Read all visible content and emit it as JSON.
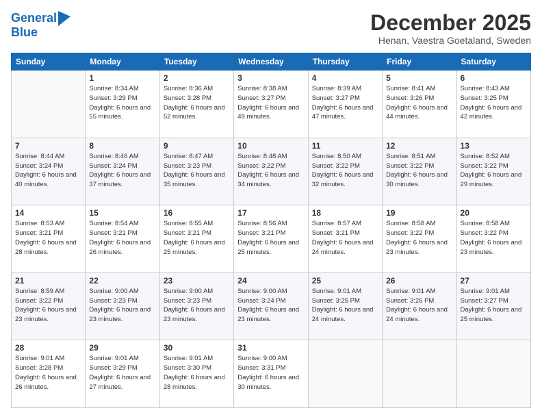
{
  "logo": {
    "line1": "General",
    "line2": "Blue"
  },
  "title": "December 2025",
  "subtitle": "Henan, Vaestra Goetaland, Sweden",
  "days_of_week": [
    "Sunday",
    "Monday",
    "Tuesday",
    "Wednesday",
    "Thursday",
    "Friday",
    "Saturday"
  ],
  "weeks": [
    [
      {
        "day": "",
        "info": ""
      },
      {
        "day": "1",
        "info": "Sunrise: 8:34 AM\nSunset: 3:29 PM\nDaylight: 6 hours\nand 55 minutes."
      },
      {
        "day": "2",
        "info": "Sunrise: 8:36 AM\nSunset: 3:28 PM\nDaylight: 6 hours\nand 52 minutes."
      },
      {
        "day": "3",
        "info": "Sunrise: 8:38 AM\nSunset: 3:27 PM\nDaylight: 6 hours\nand 49 minutes."
      },
      {
        "day": "4",
        "info": "Sunrise: 8:39 AM\nSunset: 3:27 PM\nDaylight: 6 hours\nand 47 minutes."
      },
      {
        "day": "5",
        "info": "Sunrise: 8:41 AM\nSunset: 3:26 PM\nDaylight: 6 hours\nand 44 minutes."
      },
      {
        "day": "6",
        "info": "Sunrise: 8:43 AM\nSunset: 3:25 PM\nDaylight: 6 hours\nand 42 minutes."
      }
    ],
    [
      {
        "day": "7",
        "info": "Sunrise: 8:44 AM\nSunset: 3:24 PM\nDaylight: 6 hours\nand 40 minutes."
      },
      {
        "day": "8",
        "info": "Sunrise: 8:46 AM\nSunset: 3:24 PM\nDaylight: 6 hours\nand 37 minutes."
      },
      {
        "day": "9",
        "info": "Sunrise: 8:47 AM\nSunset: 3:23 PM\nDaylight: 6 hours\nand 35 minutes."
      },
      {
        "day": "10",
        "info": "Sunrise: 8:48 AM\nSunset: 3:22 PM\nDaylight: 6 hours\nand 34 minutes."
      },
      {
        "day": "11",
        "info": "Sunrise: 8:50 AM\nSunset: 3:22 PM\nDaylight: 6 hours\nand 32 minutes."
      },
      {
        "day": "12",
        "info": "Sunrise: 8:51 AM\nSunset: 3:22 PM\nDaylight: 6 hours\nand 30 minutes."
      },
      {
        "day": "13",
        "info": "Sunrise: 8:52 AM\nSunset: 3:22 PM\nDaylight: 6 hours\nand 29 minutes."
      }
    ],
    [
      {
        "day": "14",
        "info": "Sunrise: 8:53 AM\nSunset: 3:21 PM\nDaylight: 6 hours\nand 28 minutes."
      },
      {
        "day": "15",
        "info": "Sunrise: 8:54 AM\nSunset: 3:21 PM\nDaylight: 6 hours\nand 26 minutes."
      },
      {
        "day": "16",
        "info": "Sunrise: 8:55 AM\nSunset: 3:21 PM\nDaylight: 6 hours\nand 25 minutes."
      },
      {
        "day": "17",
        "info": "Sunrise: 8:56 AM\nSunset: 3:21 PM\nDaylight: 6 hours\nand 25 minutes."
      },
      {
        "day": "18",
        "info": "Sunrise: 8:57 AM\nSunset: 3:21 PM\nDaylight: 6 hours\nand 24 minutes."
      },
      {
        "day": "19",
        "info": "Sunrise: 8:58 AM\nSunset: 3:22 PM\nDaylight: 6 hours\nand 23 minutes."
      },
      {
        "day": "20",
        "info": "Sunrise: 8:58 AM\nSunset: 3:22 PM\nDaylight: 6 hours\nand 23 minutes."
      }
    ],
    [
      {
        "day": "21",
        "info": "Sunrise: 8:59 AM\nSunset: 3:22 PM\nDaylight: 6 hours\nand 23 minutes."
      },
      {
        "day": "22",
        "info": "Sunrise: 9:00 AM\nSunset: 3:23 PM\nDaylight: 6 hours\nand 23 minutes."
      },
      {
        "day": "23",
        "info": "Sunrise: 9:00 AM\nSunset: 3:23 PM\nDaylight: 6 hours\nand 23 minutes."
      },
      {
        "day": "24",
        "info": "Sunrise: 9:00 AM\nSunset: 3:24 PM\nDaylight: 6 hours\nand 23 minutes."
      },
      {
        "day": "25",
        "info": "Sunrise: 9:01 AM\nSunset: 3:25 PM\nDaylight: 6 hours\nand 24 minutes."
      },
      {
        "day": "26",
        "info": "Sunrise: 9:01 AM\nSunset: 3:26 PM\nDaylight: 6 hours\nand 24 minutes."
      },
      {
        "day": "27",
        "info": "Sunrise: 9:01 AM\nSunset: 3:27 PM\nDaylight: 6 hours\nand 25 minutes."
      }
    ],
    [
      {
        "day": "28",
        "info": "Sunrise: 9:01 AM\nSunset: 3:28 PM\nDaylight: 6 hours\nand 26 minutes."
      },
      {
        "day": "29",
        "info": "Sunrise: 9:01 AM\nSunset: 3:29 PM\nDaylight: 6 hours\nand 27 minutes."
      },
      {
        "day": "30",
        "info": "Sunrise: 9:01 AM\nSunset: 3:30 PM\nDaylight: 6 hours\nand 28 minutes."
      },
      {
        "day": "31",
        "info": "Sunrise: 9:00 AM\nSunset: 3:31 PM\nDaylight: 6 hours\nand 30 minutes."
      },
      {
        "day": "",
        "info": ""
      },
      {
        "day": "",
        "info": ""
      },
      {
        "day": "",
        "info": ""
      }
    ]
  ]
}
